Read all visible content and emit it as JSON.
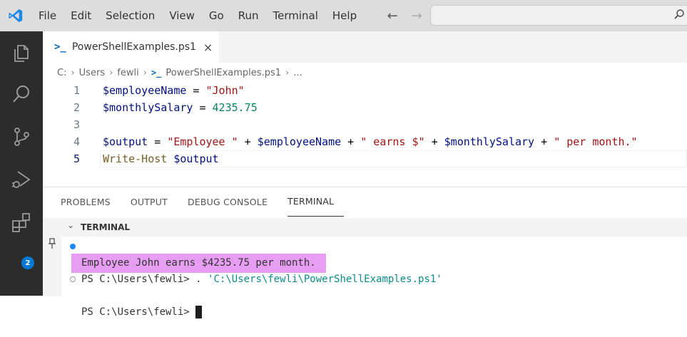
{
  "menu": {
    "items": [
      "File",
      "Edit",
      "Selection",
      "View",
      "Go",
      "Run",
      "Terminal",
      "Help"
    ]
  },
  "nav": {
    "back_icon": "arrow-left-icon",
    "forward_icon": "arrow-right-icon"
  },
  "command_center": {
    "placeholder": "",
    "icon": "search-icon"
  },
  "activity_bar": {
    "icons": [
      "explorer-icon",
      "search-icon",
      "source-control-icon",
      "run-debug-icon",
      "extensions-icon"
    ],
    "extensions_badge": "2"
  },
  "editor": {
    "tab": {
      "glyph": ">_",
      "label": "PowerShellExamples.ps1",
      "close": "×"
    },
    "breadcrumb": [
      "C:",
      "Users",
      "fewli",
      "PowerShellExamples.ps1",
      "..."
    ],
    "lines": [
      {
        "num": "1",
        "tokens": [
          [
            "var",
            "$employeeName"
          ],
          [
            "op",
            " = "
          ],
          [
            "str",
            "\"John\""
          ]
        ]
      },
      {
        "num": "2",
        "tokens": [
          [
            "var",
            "$monthlySalary"
          ],
          [
            "op",
            " = "
          ],
          [
            "num",
            "4235.75"
          ]
        ]
      },
      {
        "num": "3",
        "tokens": []
      },
      {
        "num": "4",
        "tokens": [
          [
            "var",
            "$output"
          ],
          [
            "op",
            " = "
          ],
          [
            "str",
            "\"Employee \""
          ],
          [
            "op",
            " + "
          ],
          [
            "var",
            "$employeeName"
          ],
          [
            "op",
            " + "
          ],
          [
            "str",
            "\" earns $\""
          ],
          [
            "op",
            " + "
          ],
          [
            "var",
            "$monthlySalary"
          ],
          [
            "op",
            " + "
          ],
          [
            "str",
            "\" per month.\""
          ]
        ]
      },
      {
        "num": "5",
        "tokens": [
          [
            "cmd",
            "Write-Host"
          ],
          [
            "op",
            " "
          ],
          [
            "var",
            "$output"
          ]
        ]
      }
    ]
  },
  "panel": {
    "tabs": [
      "PROBLEMS",
      "OUTPUT",
      "DEBUG CONSOLE",
      "TERMINAL"
    ],
    "active_tab": "TERMINAL",
    "section_label": "TERMINAL",
    "terminal_lines": {
      "prompt1": "PS C:\\Users\\fewli> ",
      "cmd1_dot": ". ",
      "cmd1_path": "'C:\\Users\\fewli\\PowerShellExamples.ps1'",
      "output": "Employee John earns $4235.75 per month.",
      "prompt2": "PS C:\\Users\\fewli>"
    }
  },
  "colors": {
    "highlight": "#e79ef2",
    "activity_bar": "#2c2c2c",
    "badge": "#0078d4"
  }
}
